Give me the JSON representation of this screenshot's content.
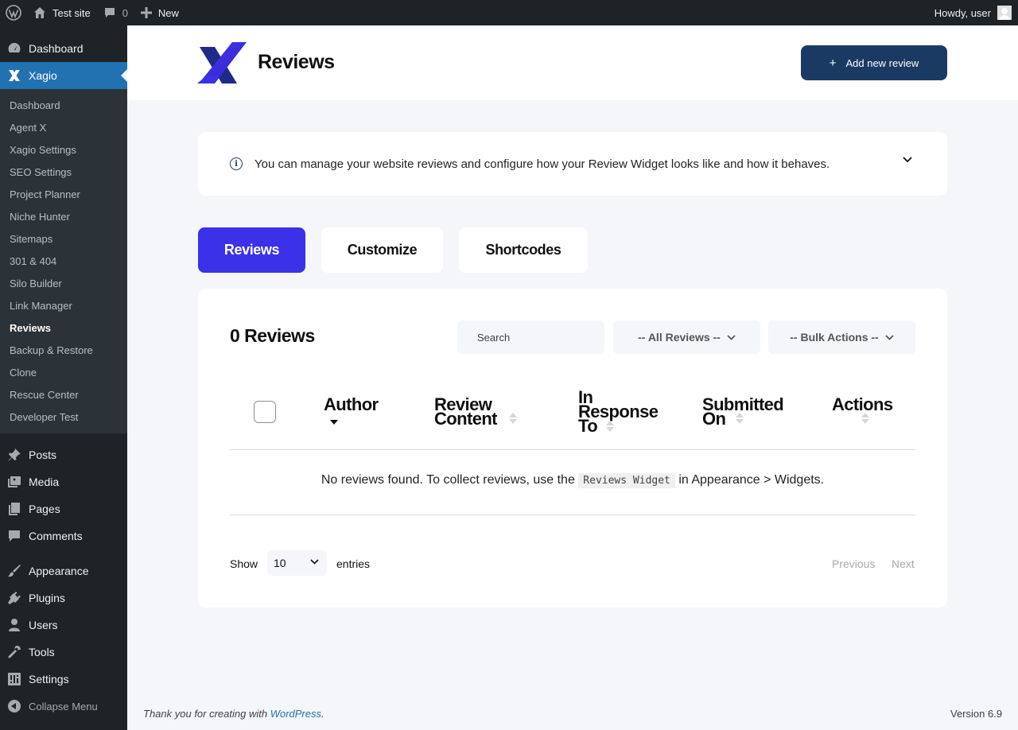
{
  "adminbar": {
    "site_name": "Test site",
    "comments_count": "0",
    "new_label": "New",
    "greeting": "Howdy, user"
  },
  "sidebar": {
    "top_items": [
      {
        "label": "Dashboard",
        "icon": "dashboard-icon"
      },
      {
        "label": "Xagio",
        "icon": "xagio-icon"
      }
    ],
    "submenu": [
      "Dashboard",
      "Agent X",
      "Xagio Settings",
      "SEO Settings",
      "Project Planner",
      "Niche Hunter",
      "Sitemaps",
      "301 & 404",
      "Silo Builder",
      "Link Manager",
      "Reviews",
      "Backup & Restore",
      "Clone",
      "Rescue Center",
      "Developer Test"
    ],
    "current_submenu": "Reviews",
    "bottom_items": [
      {
        "label": "Posts",
        "icon": "pin-icon"
      },
      {
        "label": "Media",
        "icon": "media-icon"
      },
      {
        "label": "Pages",
        "icon": "pages-icon"
      },
      {
        "label": "Comments",
        "icon": "comment-icon"
      },
      {
        "label": "Appearance",
        "icon": "brush-icon"
      },
      {
        "label": "Plugins",
        "icon": "plug-icon"
      },
      {
        "label": "Users",
        "icon": "user-icon"
      },
      {
        "label": "Tools",
        "icon": "wrench-icon"
      },
      {
        "label": "Settings",
        "icon": "settings-icon"
      }
    ],
    "collapse_label": "Collapse Menu"
  },
  "header": {
    "title": "Reviews",
    "add_button": "Add new review"
  },
  "info": {
    "text": "You can manage your website reviews and configure how your Review Widget looks like and how it behaves."
  },
  "tabs": [
    "Reviews",
    "Customize",
    "Shortcodes"
  ],
  "card": {
    "title": "0 Reviews",
    "search_placeholder": "Search",
    "filter_select": "-- All Reviews --",
    "bulk_select": "-- Bulk Actions --",
    "columns": {
      "author": "Author",
      "content_1": "Review",
      "content_2": "Content",
      "response_1": "In",
      "response_2": "Response",
      "response_3": "To",
      "submitted_1": "Submitted",
      "submitted_2": "On",
      "actions": "Actions"
    },
    "empty_before": "No reviews found. To collect reviews, use the",
    "empty_code": "Reviews Widget",
    "empty_after": "in Appearance > Widgets.",
    "show_label": "Show",
    "entries_value": "10",
    "entries_label": "entries",
    "prev_label": "Previous",
    "next_label": "Next"
  },
  "footer": {
    "thanks": "Thank you for creating with",
    "wp_link": "WordPress",
    "period": ".",
    "version": "Version 6.9"
  },
  "colors": {
    "accent": "#3a31e8",
    "brand_dark": "#1a3a63",
    "wp_blue": "#2271b1"
  }
}
